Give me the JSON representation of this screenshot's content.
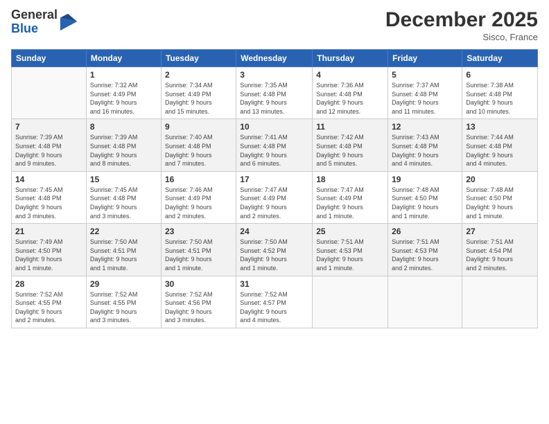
{
  "logo": {
    "general": "General",
    "blue": "Blue"
  },
  "header": {
    "month": "December 2025",
    "location": "Sisco, France"
  },
  "weekdays": [
    "Sunday",
    "Monday",
    "Tuesday",
    "Wednesday",
    "Thursday",
    "Friday",
    "Saturday"
  ],
  "weeks": [
    [
      {
        "day": "",
        "detail": ""
      },
      {
        "day": "1",
        "detail": "Sunrise: 7:32 AM\nSunset: 4:49 PM\nDaylight: 9 hours\nand 16 minutes."
      },
      {
        "day": "2",
        "detail": "Sunrise: 7:34 AM\nSunset: 4:49 PM\nDaylight: 9 hours\nand 15 minutes."
      },
      {
        "day": "3",
        "detail": "Sunrise: 7:35 AM\nSunset: 4:48 PM\nDaylight: 9 hours\nand 13 minutes."
      },
      {
        "day": "4",
        "detail": "Sunrise: 7:36 AM\nSunset: 4:48 PM\nDaylight: 9 hours\nand 12 minutes."
      },
      {
        "day": "5",
        "detail": "Sunrise: 7:37 AM\nSunset: 4:48 PM\nDaylight: 9 hours\nand 11 minutes."
      },
      {
        "day": "6",
        "detail": "Sunrise: 7:38 AM\nSunset: 4:48 PM\nDaylight: 9 hours\nand 10 minutes."
      }
    ],
    [
      {
        "day": "7",
        "detail": "Sunrise: 7:39 AM\nSunset: 4:48 PM\nDaylight: 9 hours\nand 9 minutes."
      },
      {
        "day": "8",
        "detail": "Sunrise: 7:39 AM\nSunset: 4:48 PM\nDaylight: 9 hours\nand 8 minutes."
      },
      {
        "day": "9",
        "detail": "Sunrise: 7:40 AM\nSunset: 4:48 PM\nDaylight: 9 hours\nand 7 minutes."
      },
      {
        "day": "10",
        "detail": "Sunrise: 7:41 AM\nSunset: 4:48 PM\nDaylight: 9 hours\nand 6 minutes."
      },
      {
        "day": "11",
        "detail": "Sunrise: 7:42 AM\nSunset: 4:48 PM\nDaylight: 9 hours\nand 5 minutes."
      },
      {
        "day": "12",
        "detail": "Sunrise: 7:43 AM\nSunset: 4:48 PM\nDaylight: 9 hours\nand 4 minutes."
      },
      {
        "day": "13",
        "detail": "Sunrise: 7:44 AM\nSunset: 4:48 PM\nDaylight: 9 hours\nand 4 minutes."
      }
    ],
    [
      {
        "day": "14",
        "detail": "Sunrise: 7:45 AM\nSunset: 4:48 PM\nDaylight: 9 hours\nand 3 minutes."
      },
      {
        "day": "15",
        "detail": "Sunrise: 7:45 AM\nSunset: 4:48 PM\nDaylight: 9 hours\nand 3 minutes."
      },
      {
        "day": "16",
        "detail": "Sunrise: 7:46 AM\nSunset: 4:49 PM\nDaylight: 9 hours\nand 2 minutes."
      },
      {
        "day": "17",
        "detail": "Sunrise: 7:47 AM\nSunset: 4:49 PM\nDaylight: 9 hours\nand 2 minutes."
      },
      {
        "day": "18",
        "detail": "Sunrise: 7:47 AM\nSunset: 4:49 PM\nDaylight: 9 hours\nand 1 minute."
      },
      {
        "day": "19",
        "detail": "Sunrise: 7:48 AM\nSunset: 4:50 PM\nDaylight: 9 hours\nand 1 minute."
      },
      {
        "day": "20",
        "detail": "Sunrise: 7:48 AM\nSunset: 4:50 PM\nDaylight: 9 hours\nand 1 minute."
      }
    ],
    [
      {
        "day": "21",
        "detail": "Sunrise: 7:49 AM\nSunset: 4:50 PM\nDaylight: 9 hours\nand 1 minute."
      },
      {
        "day": "22",
        "detail": "Sunrise: 7:50 AM\nSunset: 4:51 PM\nDaylight: 9 hours\nand 1 minute."
      },
      {
        "day": "23",
        "detail": "Sunrise: 7:50 AM\nSunset: 4:51 PM\nDaylight: 9 hours\nand 1 minute."
      },
      {
        "day": "24",
        "detail": "Sunrise: 7:50 AM\nSunset: 4:52 PM\nDaylight: 9 hours\nand 1 minute."
      },
      {
        "day": "25",
        "detail": "Sunrise: 7:51 AM\nSunset: 4:53 PM\nDaylight: 9 hours\nand 1 minute."
      },
      {
        "day": "26",
        "detail": "Sunrise: 7:51 AM\nSunset: 4:53 PM\nDaylight: 9 hours\nand 2 minutes."
      },
      {
        "day": "27",
        "detail": "Sunrise: 7:51 AM\nSunset: 4:54 PM\nDaylight: 9 hours\nand 2 minutes."
      }
    ],
    [
      {
        "day": "28",
        "detail": "Sunrise: 7:52 AM\nSunset: 4:55 PM\nDaylight: 9 hours\nand 2 minutes."
      },
      {
        "day": "29",
        "detail": "Sunrise: 7:52 AM\nSunset: 4:55 PM\nDaylight: 9 hours\nand 3 minutes."
      },
      {
        "day": "30",
        "detail": "Sunrise: 7:52 AM\nSunset: 4:56 PM\nDaylight: 9 hours\nand 3 minutes."
      },
      {
        "day": "31",
        "detail": "Sunrise: 7:52 AM\nSunset: 4:57 PM\nDaylight: 9 hours\nand 4 minutes."
      },
      {
        "day": "",
        "detail": ""
      },
      {
        "day": "",
        "detail": ""
      },
      {
        "day": "",
        "detail": ""
      }
    ]
  ]
}
